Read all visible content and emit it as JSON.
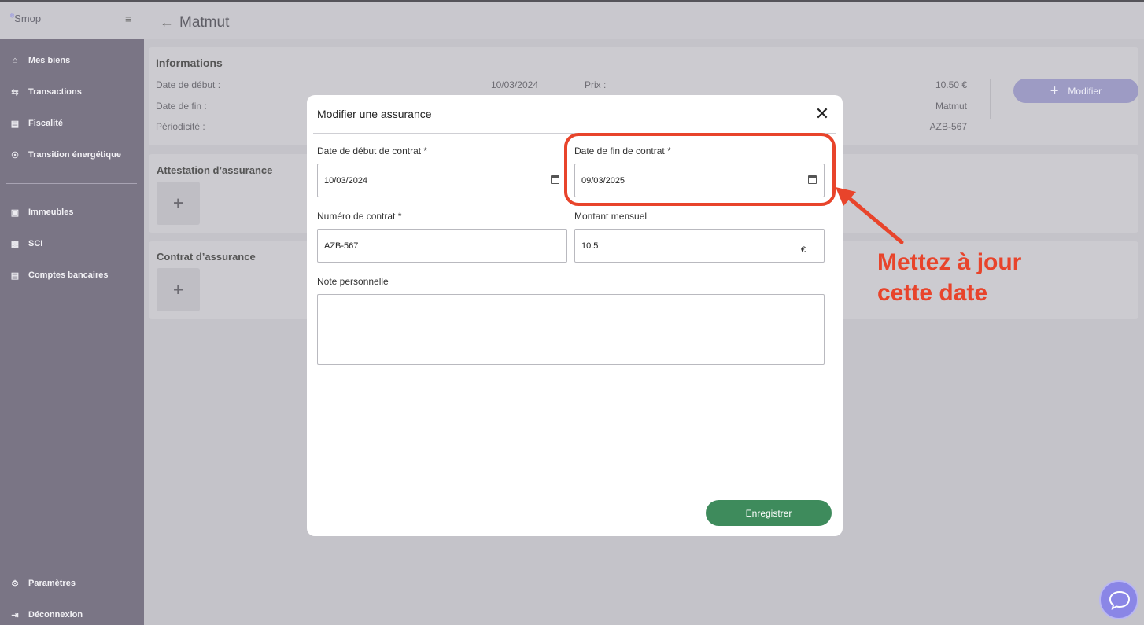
{
  "app": {
    "logo": "Smop",
    "logo_mark": "®"
  },
  "sidebar": {
    "items": [
      {
        "label": "Mes biens",
        "icon": "home-icon"
      },
      {
        "label": "Transactions",
        "icon": "swap-icon"
      },
      {
        "label": "Fiscalité",
        "icon": "document-icon"
      },
      {
        "label": "Transition énergétique",
        "icon": "energy-icon"
      },
      {
        "label": "Immeubles",
        "icon": "buildings-icon"
      },
      {
        "label": "SCI",
        "icon": "briefcase-icon"
      },
      {
        "label": "Comptes bancaires",
        "icon": "bank-icon"
      }
    ],
    "footer": [
      {
        "label": "Paramètres",
        "icon": "gear-icon"
      },
      {
        "label": "Déconnexion",
        "icon": "logout-icon"
      }
    ]
  },
  "header": {
    "title": "Matmut"
  },
  "info": {
    "title": "Informations",
    "rows": [
      {
        "label": "Date de début :",
        "value": "10/03/2024",
        "label2": "Prix :",
        "value2": "10.50 €"
      },
      {
        "label": "Date de fin :",
        "value": "",
        "label2": "",
        "value2": "Matmut"
      },
      {
        "label": "Périodicité :",
        "value": "",
        "label2": "",
        "value2": "AZB-567"
      }
    ],
    "modify_label": "Modifier"
  },
  "attestation": {
    "title": "Attestation d’assurance",
    "add": "+"
  },
  "contrat": {
    "title": "Contrat d’assurance",
    "add": "+"
  },
  "modal": {
    "title": "Modifier une assurance",
    "close": "✕",
    "start_label": "Date de début de contrat *",
    "start_value": "10/03/2024",
    "end_label": "Date de fin de contrat *",
    "end_value": "09/03/2025",
    "number_label": "Numéro de contrat *",
    "number_value": "AZB-567",
    "amount_label": "Montant mensuel",
    "amount_value": "10.5",
    "currency": "€",
    "note_label": "Note personnelle",
    "note_value": "",
    "save_label": "Enregistrer"
  },
  "annotation": {
    "line1": "Mettez à jour",
    "line2": "cette date",
    "color": "#e8442b"
  },
  "colors": {
    "sidebar": "#7a7585",
    "accent": "#9d9bc4",
    "save": "#3e8b5c",
    "chat": "#8a86e6"
  }
}
